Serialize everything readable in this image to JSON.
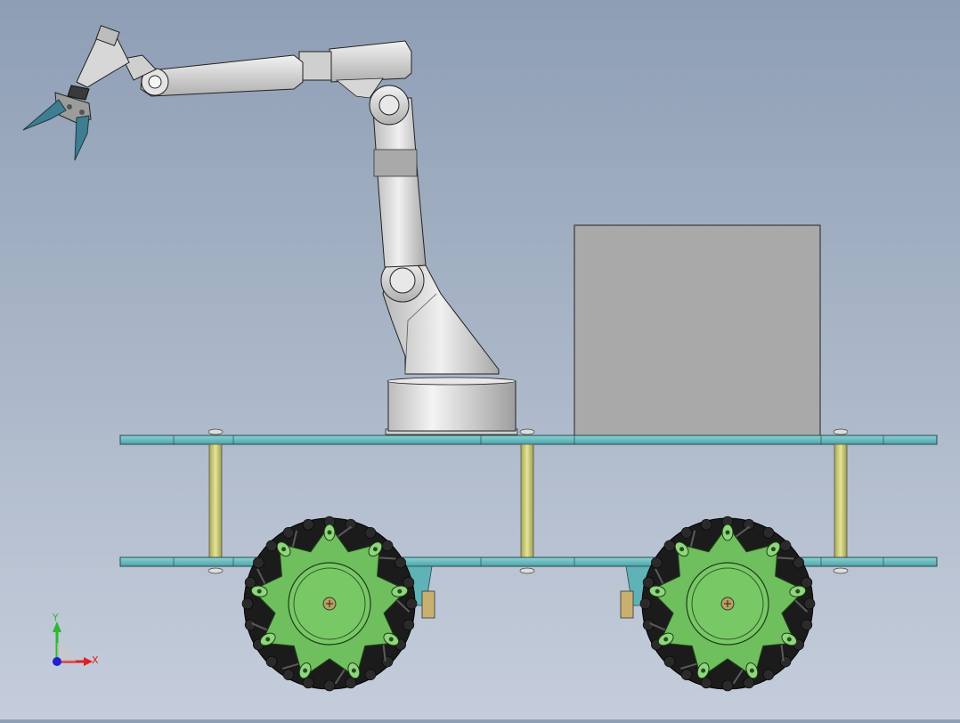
{
  "viewport": {
    "background_top": "#8e9eb5",
    "background_bottom": "#c5cddb"
  },
  "model": {
    "parts": {
      "arm": "robot-arm",
      "gripper": "gripper",
      "box": "control-box",
      "platforms": [
        "top-platform",
        "bottom-platform"
      ],
      "standoffs": 3,
      "wheels": [
        "left-mecanum-wheel",
        "right-mecanum-wheel"
      ]
    },
    "colors": {
      "arm": "#d9d9d9",
      "plate": "#6fc1c4",
      "standoff": "#cfcf7a",
      "hub": "#6fbf5e",
      "tire": "#1a1a1a",
      "box": "#a6a6a6"
    }
  },
  "triad": {
    "y_label": "Y",
    "x_label": "X",
    "y_color": "#2db82d",
    "x_color": "#e02020",
    "z_color": "#2020d0"
  }
}
